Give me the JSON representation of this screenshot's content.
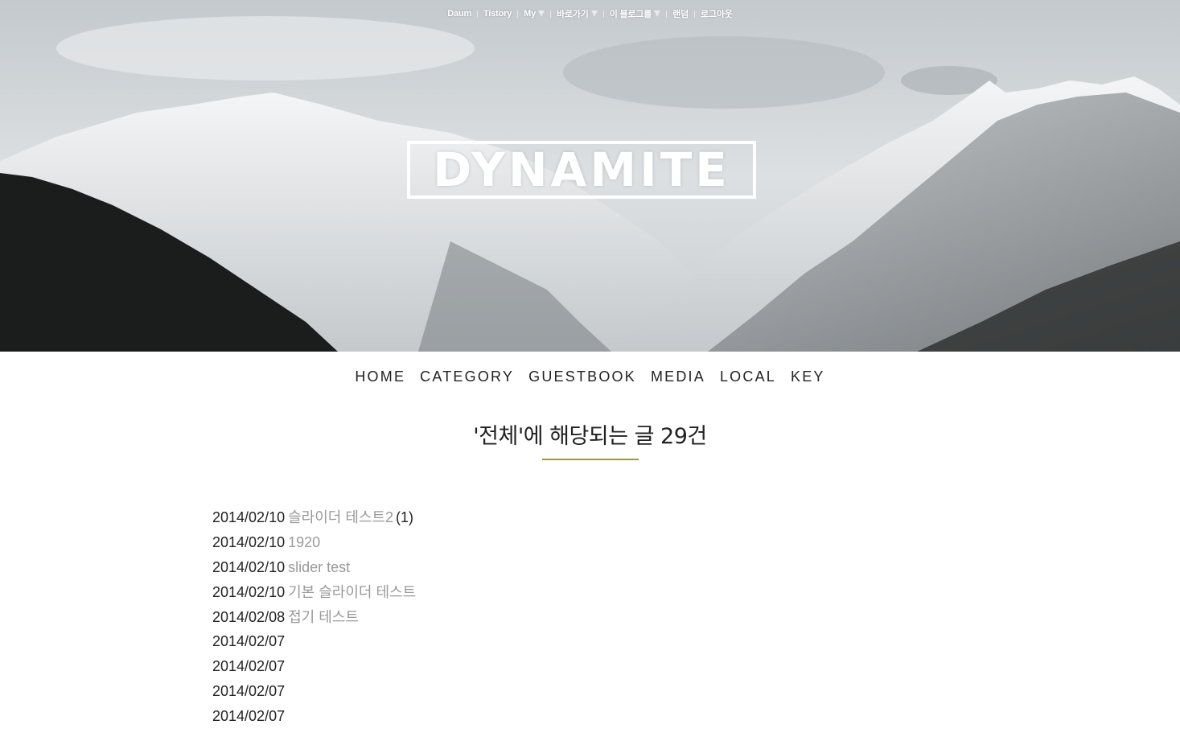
{
  "topbar": {
    "items": [
      {
        "label": "Daum",
        "has_caret": false
      },
      {
        "label": "Tistory",
        "has_caret": false
      },
      {
        "label": "My",
        "has_caret": true
      },
      {
        "label": "바로가기",
        "has_caret": true
      },
      {
        "label": "이 블로그를",
        "has_caret": true
      },
      {
        "label": "랜덤",
        "has_caret": false
      },
      {
        "label": "로그아웃",
        "has_caret": false
      }
    ]
  },
  "hero": {
    "logo_text": "DYNAMITE",
    "image": "snowy-mountains-photo"
  },
  "nav": {
    "items": [
      "HOME",
      "CATEGORY",
      "GUESTBOOK",
      "MEDIA",
      "LOCAL",
      "KEY"
    ]
  },
  "page": {
    "heading": "'전체'에 해당되는 글 29건",
    "accent_color": "#a09a2c"
  },
  "posts": [
    {
      "date": "2014/02/10",
      "title": "슬라이더 테스트2",
      "comments": "(1)"
    },
    {
      "date": "2014/02/10",
      "title": "1920",
      "comments": ""
    },
    {
      "date": "2014/02/10",
      "title": "slider test",
      "comments": ""
    },
    {
      "date": "2014/02/10",
      "title": "기본 슬라이더 테스트",
      "comments": ""
    },
    {
      "date": "2014/02/08",
      "title": "접기 테스트",
      "comments": ""
    },
    {
      "date": "2014/02/07",
      "title": "",
      "comments": ""
    },
    {
      "date": "2014/02/07",
      "title": "",
      "comments": ""
    },
    {
      "date": "2014/02/07",
      "title": "",
      "comments": ""
    },
    {
      "date": "2014/02/07",
      "title": "",
      "comments": ""
    }
  ]
}
